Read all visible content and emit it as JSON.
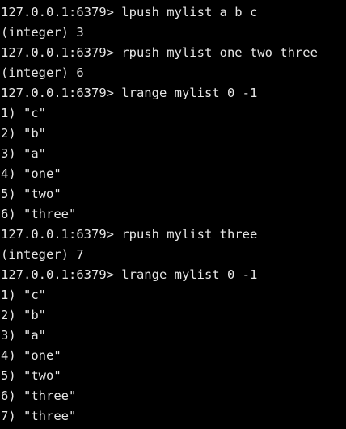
{
  "terminal": {
    "text_color": "#e6e6e6",
    "background": "#000000",
    "lines": [
      "127.0.0.1:6379> lpush mylist a b c",
      "(integer) 3",
      "127.0.0.1:6379> rpush mylist one two three",
      "(integer) 6",
      "127.0.0.1:6379> lrange mylist 0 -1",
      "1) \"c\"",
      "2) \"b\"",
      "3) \"a\"",
      "4) \"one\"",
      "5) \"two\"",
      "6) \"three\"",
      "127.0.0.1:6379> rpush mylist three",
      "(integer) 7",
      "127.0.0.1:6379> lrange mylist 0 -1",
      "1) \"c\"",
      "2) \"b\"",
      "3) \"a\"",
      "4) \"one\"",
      "5) \"two\"",
      "6) \"three\"",
      "7) \"three\""
    ]
  }
}
